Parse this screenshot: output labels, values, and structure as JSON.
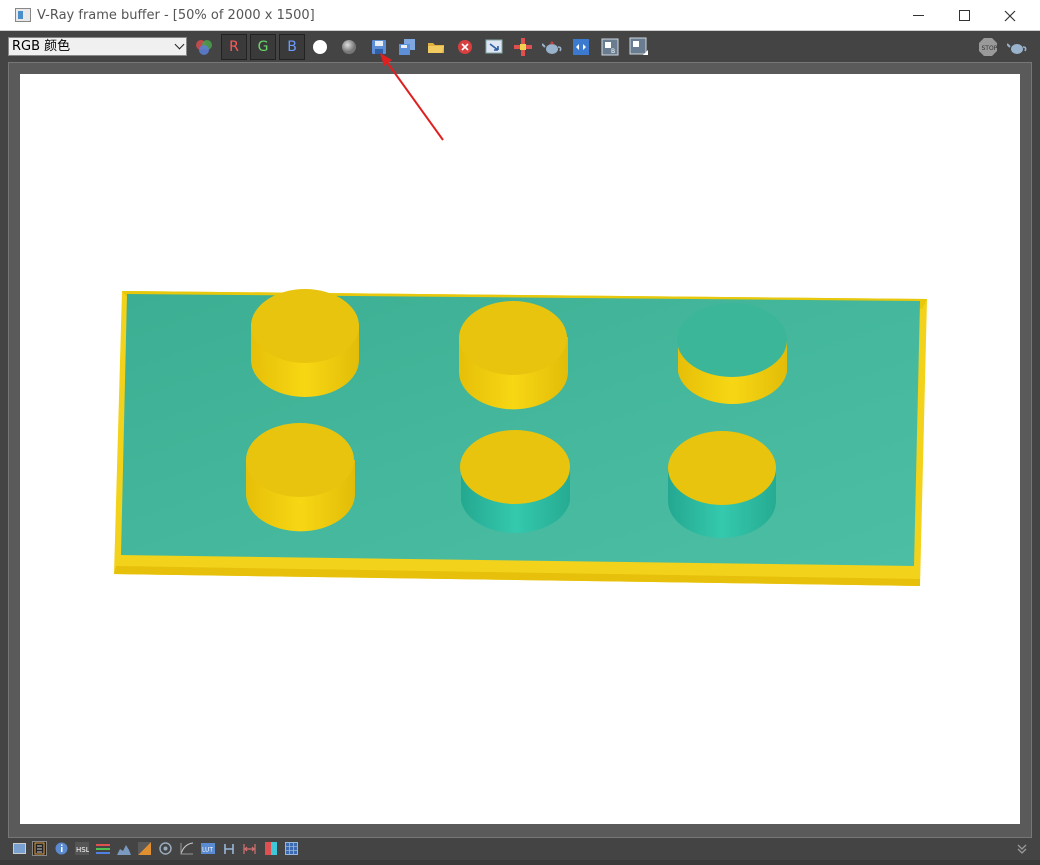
{
  "window": {
    "title": "V-Ray frame buffer - [50% of 2000 x 1500]"
  },
  "toolbar": {
    "channel_value": "RGB 颜色",
    "r_label": "R",
    "g_label": "G",
    "b_label": "B"
  },
  "colors": {
    "plate_top": "#3fb59a",
    "plate_edge": "#f2d21a",
    "stud_top": "#e8c40e",
    "stud_side": "#f0cc10",
    "stud_teal": "#35c7ad",
    "annotation": "#e02020"
  },
  "icons": {
    "color_balance": "color-circles-icon",
    "save": "save-icon",
    "stop": "stop-icon",
    "teapot": "teapot-icon"
  }
}
